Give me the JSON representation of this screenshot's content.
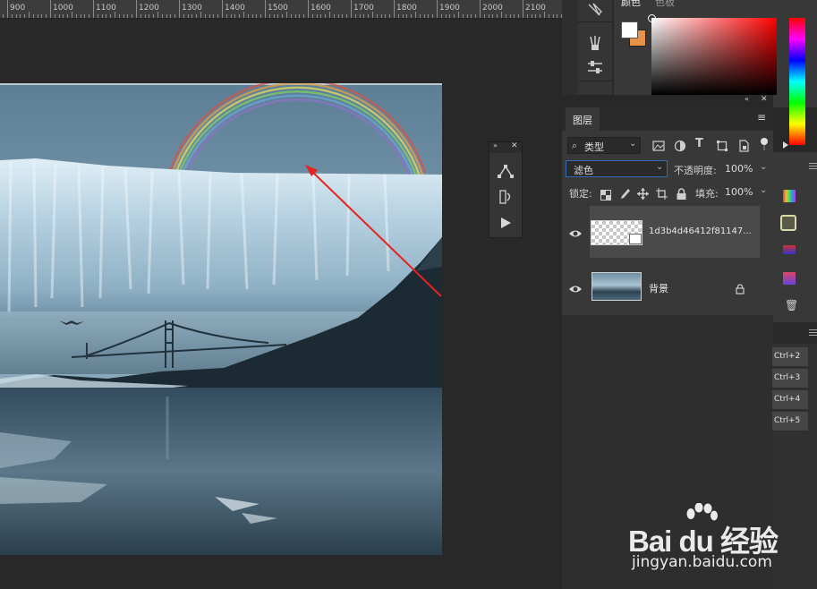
{
  "ruler": {
    "labels": [
      "900",
      "1000",
      "1100",
      "1200",
      "1300",
      "1400",
      "1500",
      "1600",
      "1700",
      "1800",
      "1900",
      "2000",
      "2100"
    ]
  },
  "color_panel": {
    "tab_color": "颜色",
    "tab_swatches": "色板",
    "foreground_color": "#ffffff",
    "background_color": "#e79149"
  },
  "layers_panel": {
    "tab_label": "图层",
    "filter_kind": "类型",
    "blend_mode": "滤色",
    "opacity_label": "不透明度:",
    "opacity_value": "100%",
    "lock_label": "锁定:",
    "fill_label": "填充:",
    "fill_value": "100%",
    "layers": [
      {
        "name": "1d3b4d46412f81147...",
        "visible": true,
        "selected": true
      },
      {
        "name": "背景",
        "visible": true,
        "selected": false,
        "locked": true
      }
    ]
  },
  "shortcuts": [
    "Ctrl+2",
    "Ctrl+3",
    "Ctrl+4",
    "Ctrl+5"
  ],
  "watermark": {
    "brand": "Bai du 经验",
    "url": "jingyan.baidu.com"
  },
  "colors": {
    "selection_highlight": "#2f6db5",
    "annotation_arrow": "#e8221e"
  }
}
